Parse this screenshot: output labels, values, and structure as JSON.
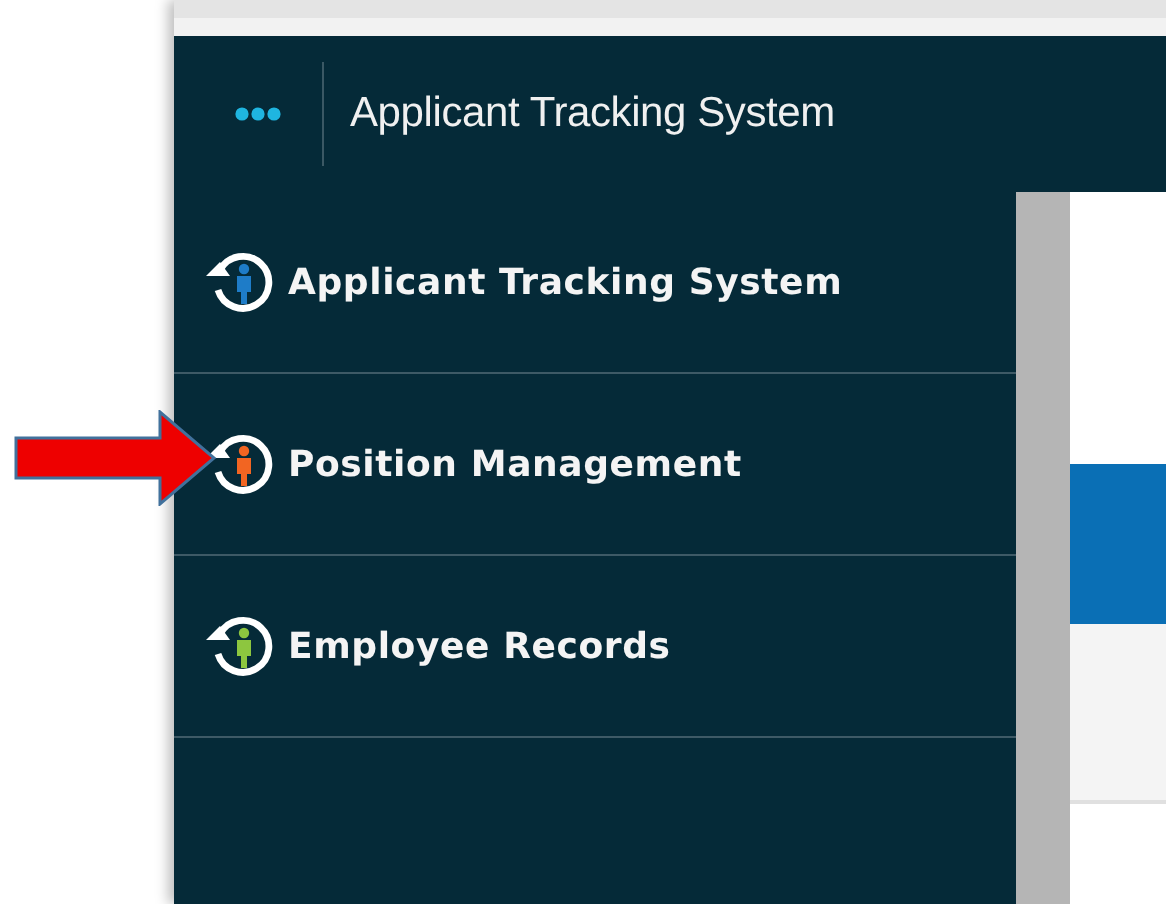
{
  "header": {
    "title": "Applicant Tracking System"
  },
  "sidebar": {
    "items": [
      {
        "label": "Applicant Tracking System",
        "color": "#1e7cc8"
      },
      {
        "label": "Position Management",
        "color": "#f26522",
        "pointed_at": true
      },
      {
        "label": "Employee Records",
        "color": "#8dc63f"
      }
    ]
  }
}
